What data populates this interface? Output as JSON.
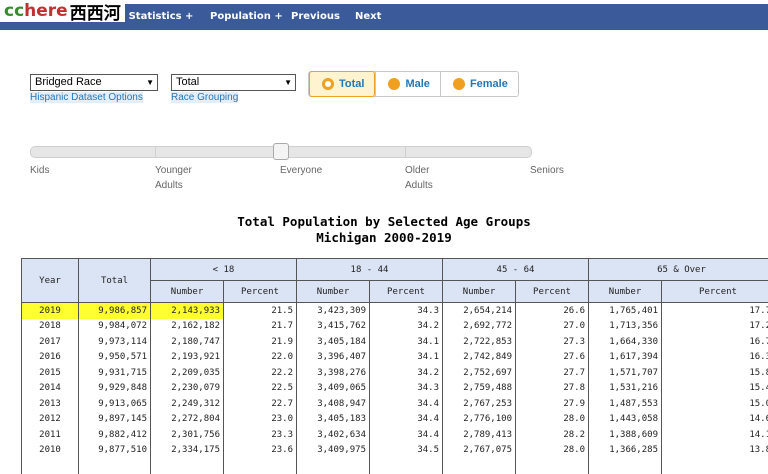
{
  "watermark": {
    "cc": "cc",
    "here": "here",
    "cn": "西西河"
  },
  "nav": {
    "items": [
      "h Statistics +",
      "Population +",
      "Previous",
      "Next"
    ]
  },
  "controls": {
    "race_select": "Bridged Race",
    "group_select": "Total",
    "hispanic_link": "Hispanic Dataset Options",
    "race_link": "Race Grouping",
    "gender": [
      "Total",
      "Male",
      "Female"
    ],
    "gender_selected": "Total"
  },
  "slider": {
    "labels": [
      "Kids",
      "Younger Adults",
      "Everyone",
      "Older Adults",
      "Seniors"
    ],
    "label_lines": [
      [
        "Kids"
      ],
      [
        "Younger",
        "Adults"
      ],
      [
        "Everyone"
      ],
      [
        "Older",
        "Adults"
      ],
      [
        "Seniors"
      ]
    ],
    "selected": "Everyone"
  },
  "report": {
    "title": "Total Population by Selected Age Groups",
    "subtitle": "Michigan 2000-2019"
  },
  "table": {
    "col_year": "Year",
    "col_total": "Total",
    "groups": [
      "< 18",
      "18 - 44",
      "45 - 64",
      "65 & Over"
    ],
    "sub": [
      "Number",
      "Percent"
    ],
    "rows": [
      {
        "year": "2019",
        "total": "9,986,857",
        "cells": [
          "2,143,933",
          "21.5",
          "3,423,309",
          "34.3",
          "2,654,214",
          "26.6",
          "1,765,401",
          "17.7"
        ]
      },
      {
        "year": "2018",
        "total": "9,984,072",
        "cells": [
          "2,162,182",
          "21.7",
          "3,415,762",
          "34.2",
          "2,692,772",
          "27.0",
          "1,713,356",
          "17.2"
        ]
      },
      {
        "year": "2017",
        "total": "9,973,114",
        "cells": [
          "2,180,747",
          "21.9",
          "3,405,184",
          "34.1",
          "2,722,853",
          "27.3",
          "1,664,330",
          "16.7"
        ]
      },
      {
        "year": "2016",
        "total": "9,950,571",
        "cells": [
          "2,193,921",
          "22.0",
          "3,396,407",
          "34.1",
          "2,742,849",
          "27.6",
          "1,617,394",
          "16.3"
        ]
      },
      {
        "year": "2015",
        "total": "9,931,715",
        "cells": [
          "2,209,035",
          "22.2",
          "3,398,276",
          "34.2",
          "2,752,697",
          "27.7",
          "1,571,707",
          "15.8"
        ]
      },
      {
        "year": "2014",
        "total": "9,929,848",
        "cells": [
          "2,230,079",
          "22.5",
          "3,409,065",
          "34.3",
          "2,759,488",
          "27.8",
          "1,531,216",
          "15.4"
        ]
      },
      {
        "year": "2013",
        "total": "9,913,065",
        "cells": [
          "2,249,312",
          "22.7",
          "3,408,947",
          "34.4",
          "2,767,253",
          "27.9",
          "1,487,553",
          "15.0"
        ]
      },
      {
        "year": "2012",
        "total": "9,897,145",
        "cells": [
          "2,272,804",
          "23.0",
          "3,405,183",
          "34.4",
          "2,776,100",
          "28.0",
          "1,443,058",
          "14.6"
        ]
      },
      {
        "year": "2011",
        "total": "9,882,412",
        "cells": [
          "2,301,756",
          "23.3",
          "3,402,634",
          "34.4",
          "2,789,413",
          "28.2",
          "1,388,609",
          "14.1"
        ]
      },
      {
        "year": "2010",
        "total": "9,877,510",
        "cells": [
          "2,334,175",
          "23.6",
          "3,409,975",
          "34.5",
          "2,767,075",
          "28.0",
          "1,366,285",
          "13.8"
        ]
      }
    ],
    "highlight_year": "2019"
  },
  "colors": {
    "nav_bg": "#3a5a99",
    "header_bg": "#dbe4f4",
    "highlight": "#ffff30",
    "accent": "#f0a020",
    "link": "#2277bb"
  }
}
